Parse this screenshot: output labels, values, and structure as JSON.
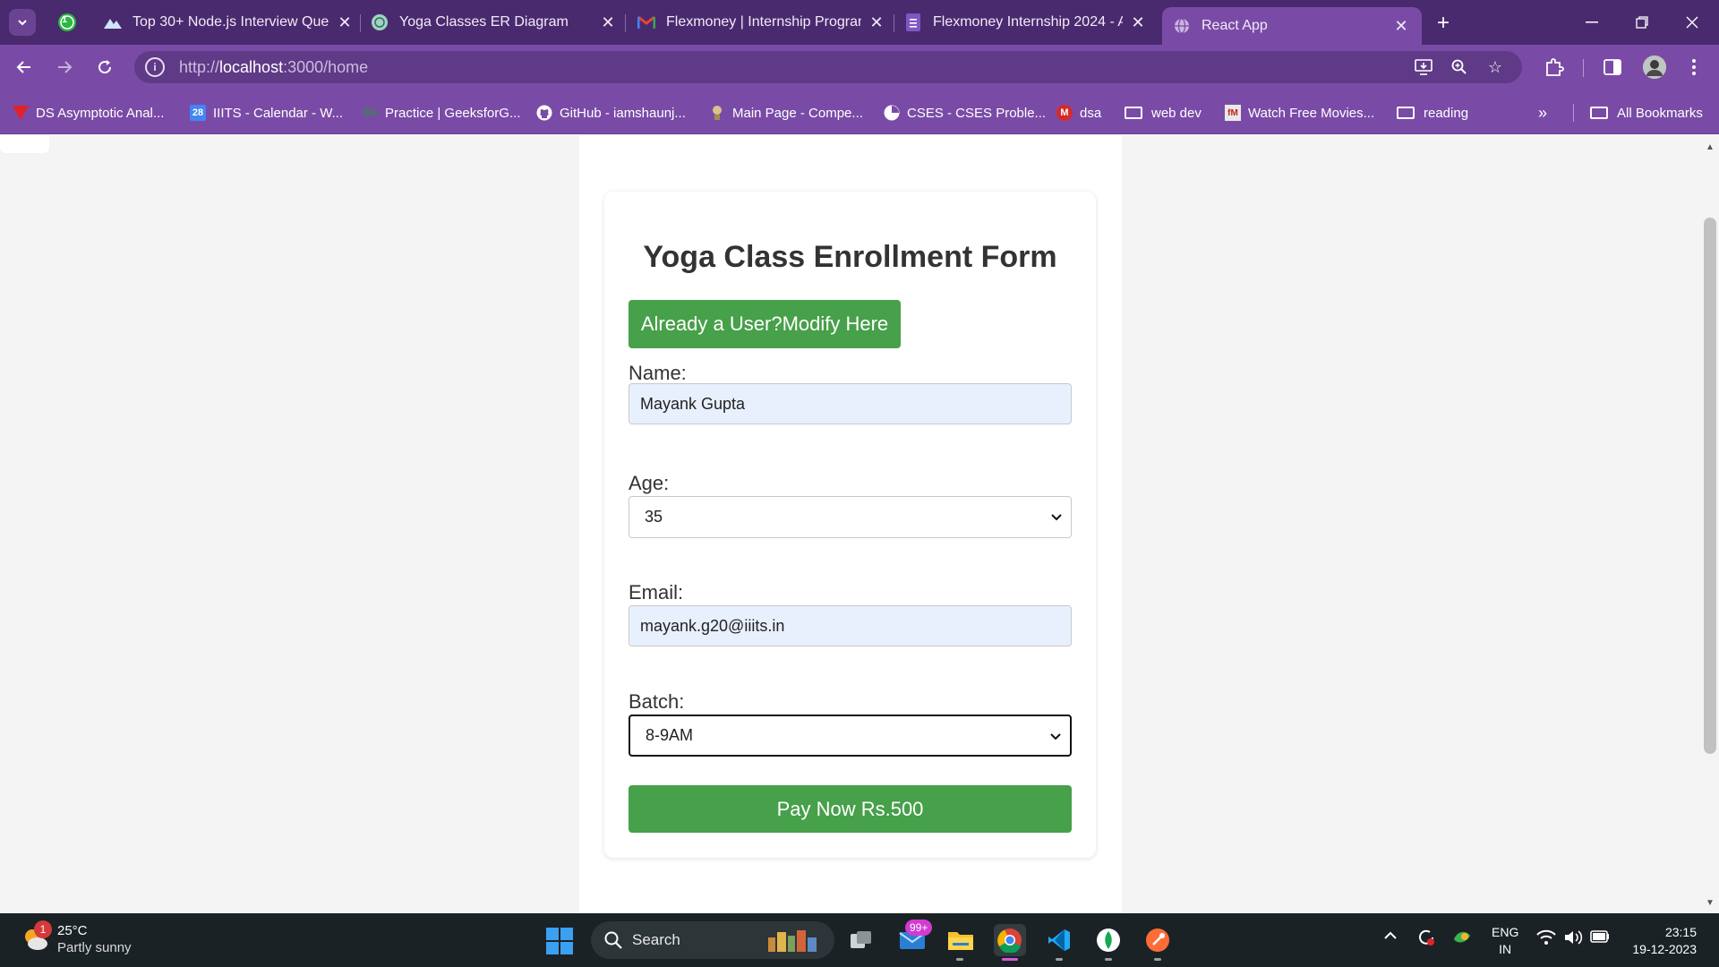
{
  "browser": {
    "tabs": [
      {
        "title": "Top 30+ Node.js Interview Que",
        "favicon": "mountain-icon"
      },
      {
        "title": "Yoga Classes ER Diagram",
        "favicon": "chatgpt-icon"
      },
      {
        "title": "Flexmoney | Internship Program",
        "favicon": "gmail-icon"
      },
      {
        "title": "Flexmoney Internship 2024 - As",
        "favicon": "forms-icon"
      },
      {
        "title": "React App",
        "favicon": "globe-icon",
        "active": true
      }
    ],
    "whatsapp_badge": "1",
    "url_prefix": "http://",
    "url_host": "localhost",
    "url_rest": ":3000/home"
  },
  "bookmarks": [
    "DS Asymptotic Anal...",
    "IIITS - Calendar - W...",
    "Practice | GeeksforG...",
    "GitHub - iamshaunj...",
    "Main Page - Compe...",
    "CSES - CSES Proble...",
    "dsa",
    "web dev",
    "Watch Free Movies...",
    "reading"
  ],
  "all_bookmarks": "All Bookmarks",
  "calendar_icon_text": "28",
  "form": {
    "title": "Yoga Class Enrollment Form",
    "modify_button": "Already a User?Modify Here",
    "name_label": "Name:",
    "name_value": "Mayank Gupta",
    "age_label": "Age:",
    "age_value": "35",
    "email_label": "Email:",
    "email_value": "mayank.g20@iiits.in",
    "batch_label": "Batch:",
    "batch_value": "8-9AM",
    "pay_button": "Pay Now Rs.500"
  },
  "taskbar": {
    "weather_badge": "1",
    "temperature": "25°C",
    "weather_desc": "Partly sunny",
    "search_label": "Search",
    "mail_badge": "99+",
    "lang_line1": "ENG",
    "lang_line2": "IN",
    "time": "23:15",
    "date": "19-12-2023"
  },
  "colors": {
    "browser_frame": "#4a2a6e",
    "toolbar": "#7a4ba6",
    "button_green": "#47a04a"
  }
}
